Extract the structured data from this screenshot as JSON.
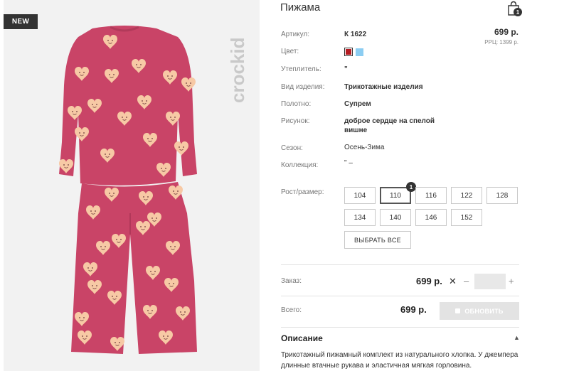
{
  "badge": "NEW",
  "brand": "crockid",
  "title": "Пижама",
  "cart": {
    "count": "1"
  },
  "price": "699 р.",
  "rrp": "РРЦ: 1399 р.",
  "attributes": [
    {
      "label": "Артикул:",
      "value": "К 1622"
    },
    {
      "label": "Цвет:",
      "value": ""
    },
    {
      "label": "Утеплитель:",
      "value": "\""
    },
    {
      "label": "Вид изделия:",
      "value": "Трикотажные изделия"
    },
    {
      "label": "Полотно:",
      "value": "Супрем"
    },
    {
      "label": "Рисунок:",
      "value": "доброе сердце на спелой вишне"
    },
    {
      "label": "Сезон:",
      "value": "Осень-Зима"
    },
    {
      "label": "Коллекция:",
      "value": "\" –"
    }
  ],
  "colors": [
    "#b51c22",
    "#8ccdf2"
  ],
  "sizes": {
    "label": "Рост/размер:",
    "options": [
      "104",
      "110",
      "116",
      "122",
      "128",
      "134",
      "140",
      "146",
      "152"
    ],
    "selected": "110",
    "selected_count": "1",
    "select_all": "ВЫБРАТЬ ВСЕ"
  },
  "order": {
    "label": "Заказ:",
    "price": "699 р.",
    "remove": "✕",
    "minus": "–",
    "plus": "+",
    "quantity": ""
  },
  "total": {
    "label": "Всего:",
    "price": "699 р.",
    "update": "ОБНОВИТЬ"
  },
  "description": {
    "title": "Описание",
    "text": "Трикотажный пижамный комплект из натурального хлопка. У джемпера длинные втачные рукава и эластичная мягкая горловина."
  },
  "icons": [
    "shopping-bag-icon",
    "chevron-up-icon",
    "close-icon"
  ]
}
